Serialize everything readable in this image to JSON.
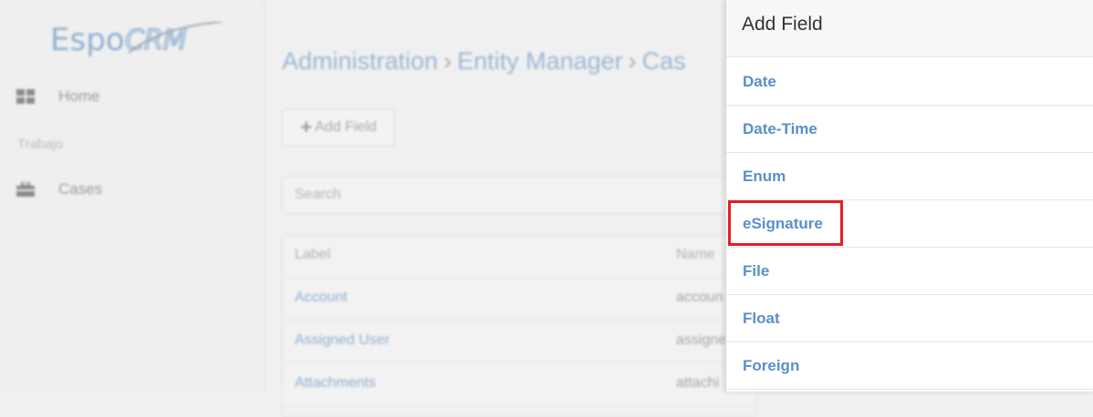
{
  "app": {
    "logo_text": "Espo CRM"
  },
  "sidebar": {
    "items": [
      {
        "label": "Home",
        "icon": "grid-icon"
      },
      {
        "label": "Cases",
        "icon": "briefcase-icon"
      }
    ],
    "section_label": "Trabajo"
  },
  "main": {
    "breadcrumb": [
      "Administration",
      "Entity Manager",
      "Cas"
    ],
    "add_field_label": "Add Field",
    "search_placeholder": "Search",
    "table": {
      "columns": [
        "Label",
        "Name"
      ],
      "rows": [
        {
          "label": "Account",
          "name": "accoun"
        },
        {
          "label": "Assigned User",
          "name": "assigne"
        },
        {
          "label": "Attachments",
          "name": "attachi"
        }
      ]
    }
  },
  "modal": {
    "title": "Add Field",
    "field_types": [
      "Date",
      "Date-Time",
      "Enum",
      "eSignature",
      "File",
      "Float",
      "Foreign"
    ],
    "highlighted_type": "eSignature",
    "highlight_color": "#e41e25",
    "link_color": "#5a8fc8"
  }
}
